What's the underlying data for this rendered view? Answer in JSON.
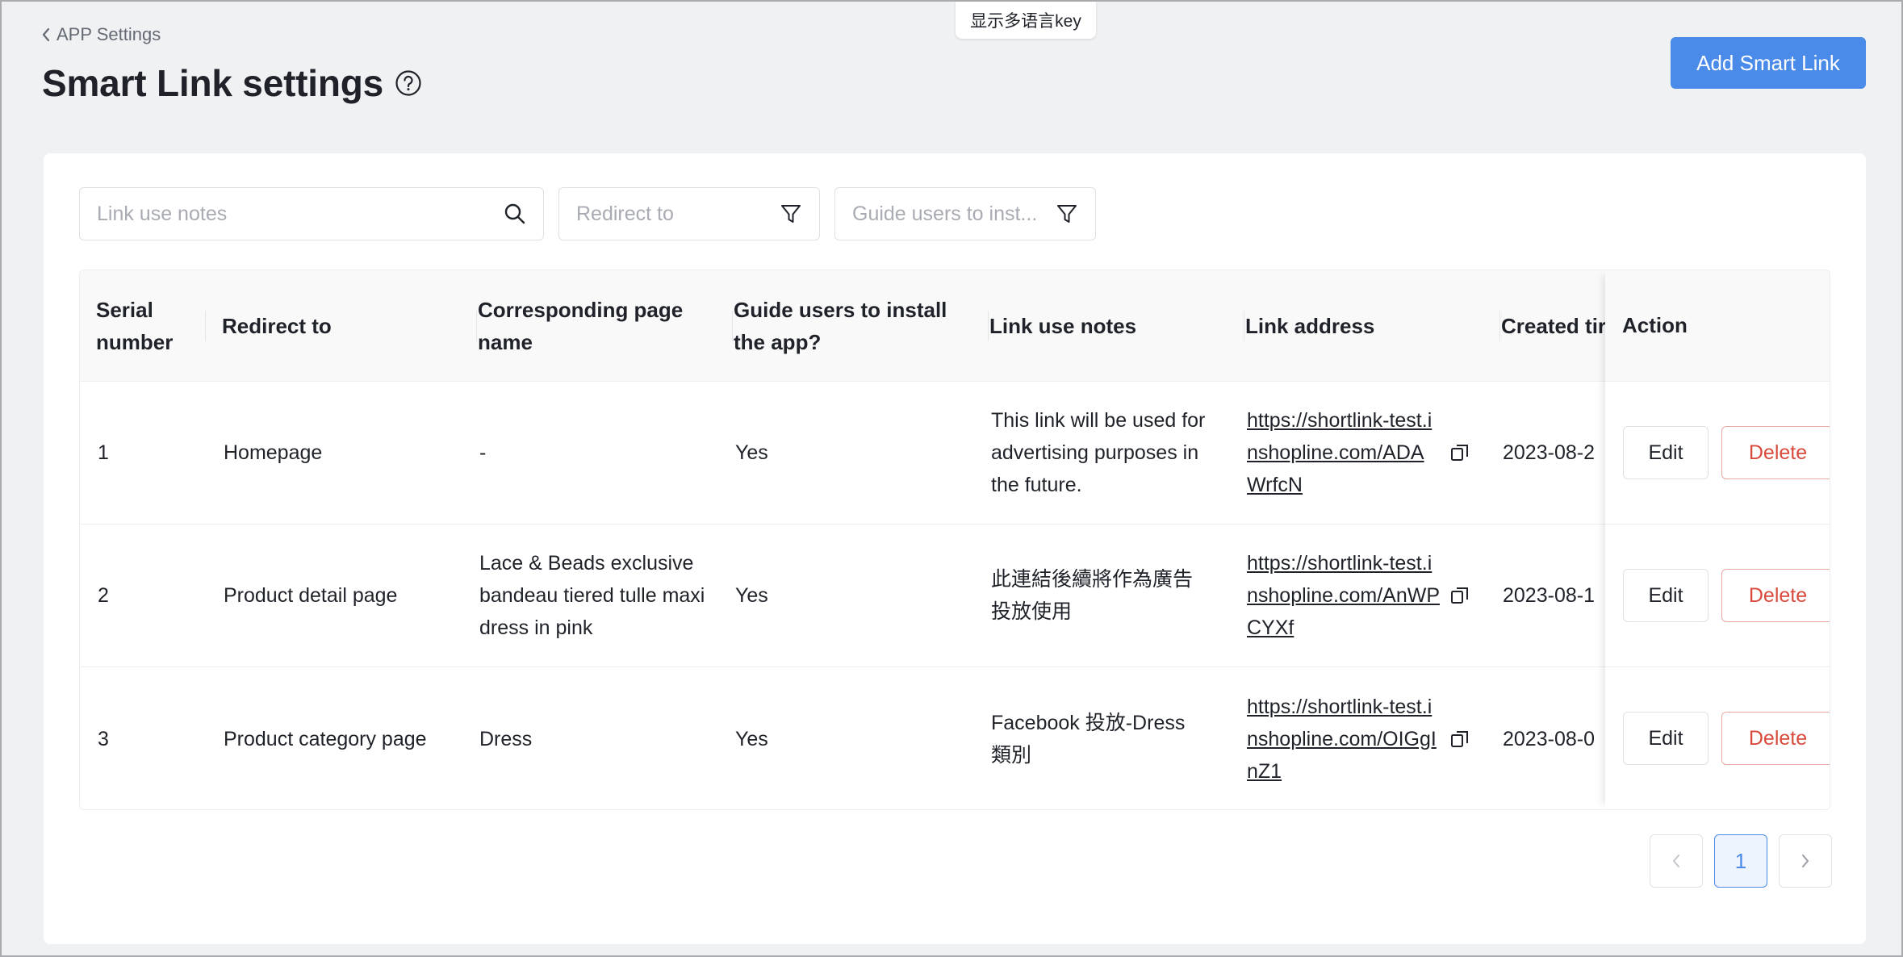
{
  "breadcrumb": {
    "label": "APP Settings"
  },
  "page": {
    "title": "Smart Link settings"
  },
  "lang_toggle": {
    "label": "显示多语言key"
  },
  "add_button": {
    "label": "Add Smart Link"
  },
  "filters": {
    "search_placeholder": "Link use notes",
    "redirect_placeholder": "Redirect to",
    "guide_placeholder": "Guide users to inst..."
  },
  "table": {
    "headers": {
      "serial": "Serial number",
      "redirect": "Redirect to",
      "page_name": "Corresponding page name",
      "guide": "Guide users to install the app?",
      "notes": "Link use notes",
      "address": "Link address",
      "created": "Created tir",
      "action": "Action"
    },
    "rows": [
      {
        "serial": "1",
        "redirect": "Homepage",
        "page_name": "-",
        "guide": "Yes",
        "notes": "This link will be used for advertising purposes in the future.",
        "address": "https://shortlink-test.inshopline.com/ADAWrfcN",
        "created": "2023-08-2"
      },
      {
        "serial": "2",
        "redirect": "Product detail page",
        "page_name": "Lace & Beads exclusive bandeau tiered tulle maxi dress in pink",
        "guide": "Yes",
        "notes": "此連結後續將作為廣告投放使用",
        "address": "https://shortlink-test.inshopline.com/AnWPCYXf",
        "created": "2023-08-1"
      },
      {
        "serial": "3",
        "redirect": "Product category page",
        "page_name": "Dress",
        "guide": "Yes",
        "notes": "Facebook 投放-Dress 類別",
        "address": "https://shortlink-test.inshopline.com/OIGgInZ1",
        "created": "2023-08-0"
      }
    ],
    "edit_label": "Edit",
    "delete_label": "Delete"
  },
  "pagination": {
    "current_page": "1"
  },
  "icons": {
    "back": "chevron-left-icon",
    "help": "question-circle-icon",
    "search": "search-icon",
    "filter": "filter-icon",
    "copy": "copy-icon",
    "prev": "chevron-left-icon",
    "next": "chevron-right-icon"
  },
  "colors": {
    "primary": "#4a8ae8",
    "danger": "#d84a3c",
    "background": "#f0f1f3"
  }
}
